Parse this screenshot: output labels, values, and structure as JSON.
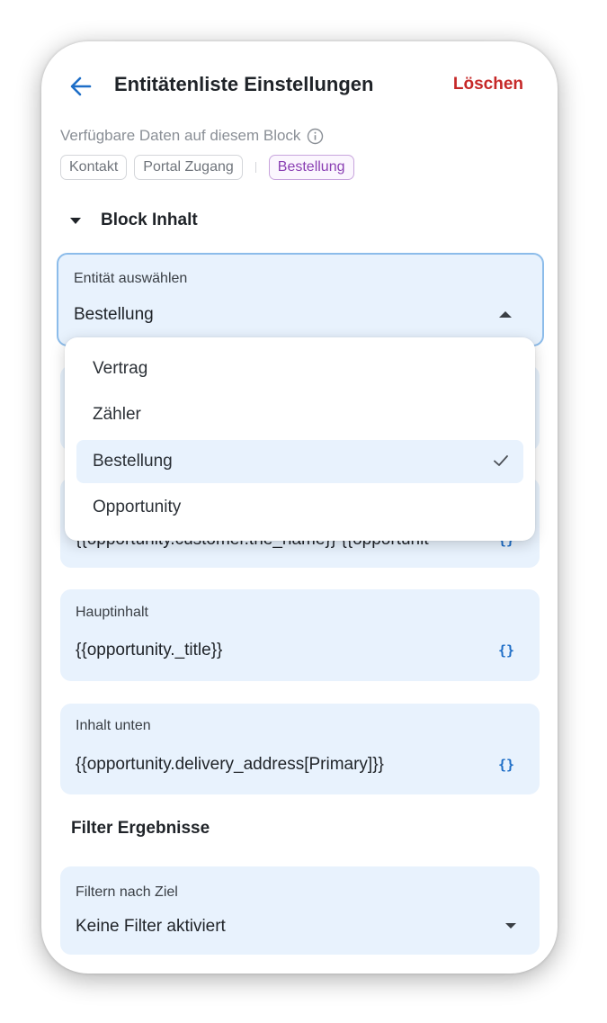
{
  "header": {
    "title": "Entitätenliste Einstellungen",
    "delete_label": "Löschen"
  },
  "available": {
    "label": "Verfügbare Daten auf diesem Block",
    "chips": [
      "Kontakt",
      "Portal Zugang"
    ],
    "active_chip": "Bestellung"
  },
  "block_content": {
    "title": "Block Inhalt"
  },
  "entity_select": {
    "label": "Entität auswählen",
    "value": "Bestellung",
    "options": [
      {
        "label": "Vertrag",
        "selected": false
      },
      {
        "label": "Zähler",
        "selected": false
      },
      {
        "label": "Bestellung",
        "selected": true
      },
      {
        "label": "Opportunity",
        "selected": false
      }
    ]
  },
  "partially_hidden_field": {
    "value": "{{opportunity.customer.the_name}} {{opportunit"
  },
  "main_content": {
    "label": "Hauptinhalt",
    "value": "{{opportunity._title}}"
  },
  "bottom_content": {
    "label": "Inhalt unten",
    "value": "{{opportunity.delivery_address[Primary]}}"
  },
  "filter_results": {
    "title": "Filter Ergebnisse",
    "label": "Filtern nach Ziel",
    "value": "Keine Filter aktiviert"
  },
  "icons": {
    "variable": "{}"
  },
  "colors": {
    "accent_blue": "#1e6ec7",
    "delete_red": "#c62828",
    "active_chip_purple": "#8a3fb3",
    "field_background": "#e8f2fd"
  }
}
